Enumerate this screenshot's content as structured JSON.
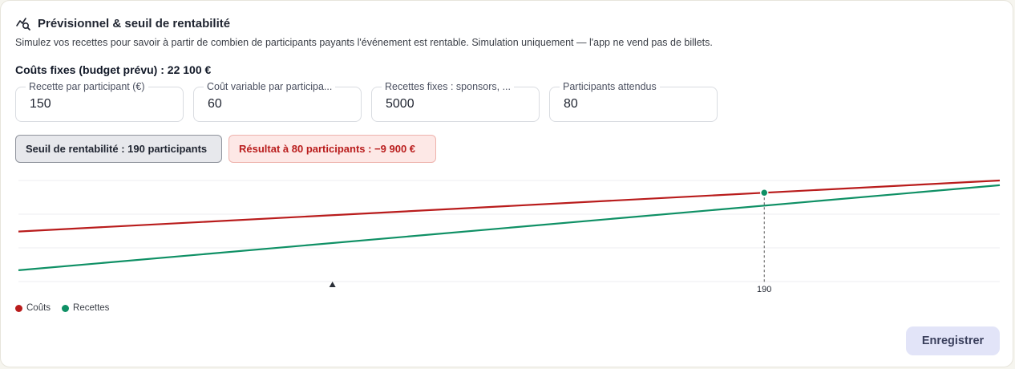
{
  "header": {
    "title": "Prévisionnel & seuil de rentabilité",
    "subtitle": "Simulez vos recettes pour savoir à partir de combien de participants payants l'événement est rentable. Simulation uniquement — l'app ne vend pas de billets."
  },
  "fixed_costs_label": "Coûts fixes (budget prévu) : 22 100 €",
  "fields": [
    {
      "label": "Recette par participant (€)",
      "value": "150"
    },
    {
      "label": "Coût variable par participa...",
      "value": "60"
    },
    {
      "label": "Recettes fixes : sponsors, ...",
      "value": "5000"
    },
    {
      "label": "Participants attendus",
      "value": "80"
    }
  ],
  "badges": {
    "threshold": "Seuil de rentabilité : 190 participants",
    "result": "Résultat à 80 participants : −9 900 €"
  },
  "chart_data": {
    "type": "line",
    "x": [
      0,
      250
    ],
    "series": [
      {
        "name": "Coûts",
        "color": "#b91c1c",
        "values": [
          22100,
          44600
        ]
      },
      {
        "name": "Recettes",
        "color": "#0f9065",
        "values": [
          5000,
          42500
        ]
      }
    ],
    "xlim": [
      0,
      250
    ],
    "ylim": [
      0,
      44600
    ],
    "grid": true,
    "break_even": {
      "x": 190,
      "y": 39200,
      "label": "190"
    },
    "expected_marker_x": 80,
    "legend_position": "bottom-left"
  },
  "legend": [
    {
      "label": "Coûts",
      "color": "#b91c1c"
    },
    {
      "label": "Recettes",
      "color": "#0f9065"
    }
  ],
  "actions": {
    "save": "Enregistrer"
  }
}
